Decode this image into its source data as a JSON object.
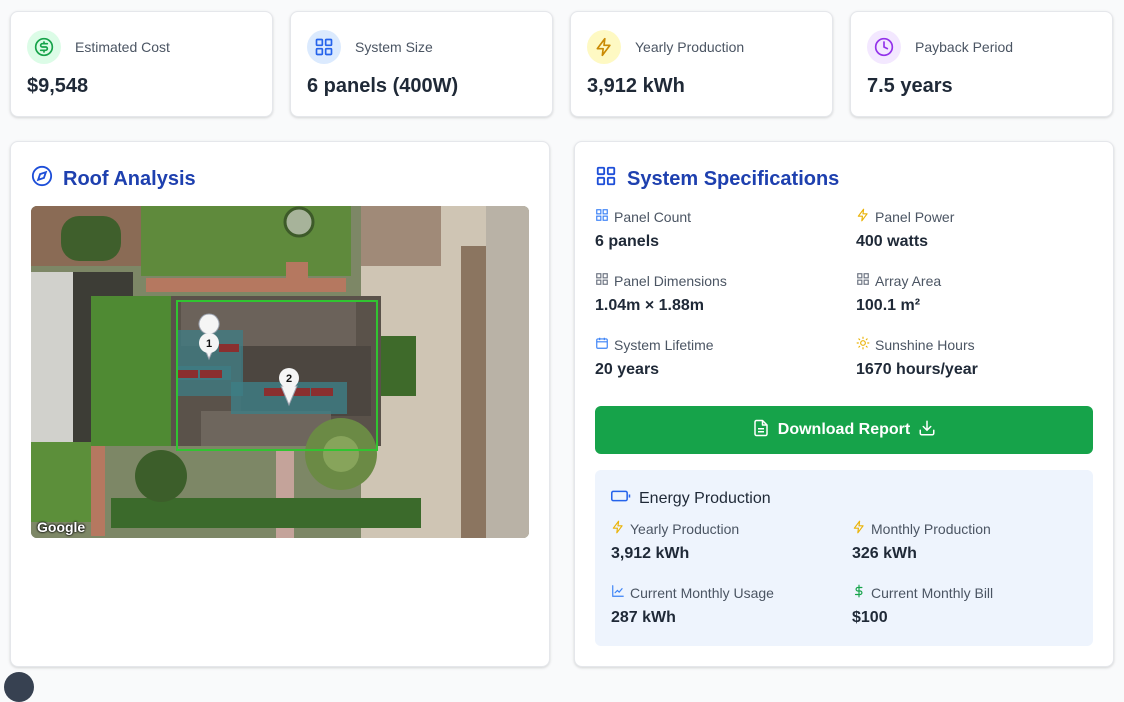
{
  "stats": [
    {
      "label": "Estimated Cost",
      "value": "$9,548",
      "icon": "dollar-circle-icon",
      "color": "#16a34a",
      "bg": "#dcfce7"
    },
    {
      "label": "System Size",
      "value": "6 panels (400W)",
      "icon": "grid-icon",
      "color": "#2563eb",
      "bg": "#dbeafe"
    },
    {
      "label": "Yearly Production",
      "value": "3,912 kWh",
      "icon": "lightning-icon",
      "color": "#ca8a04",
      "bg": "#fef9c3"
    },
    {
      "label": "Payback Period",
      "value": "7.5 years",
      "icon": "clock-icon",
      "color": "#9333ea",
      "bg": "#f3e8ff"
    }
  ],
  "roof": {
    "title": "Roof Analysis",
    "map_watermark": "Google",
    "markers": [
      "1",
      "2"
    ]
  },
  "specs": {
    "title": "System Specifications",
    "items": [
      {
        "label": "Panel Count",
        "value": "6 panels",
        "icon": "grid-icon"
      },
      {
        "label": "Panel Power",
        "value": "400 watts",
        "icon": "lightning-icon"
      },
      {
        "label": "Panel Dimensions",
        "value": "1.04m × 1.88m",
        "icon": "grid-icon"
      },
      {
        "label": "Array Area",
        "value": "100.1 m²",
        "icon": "grid-icon"
      },
      {
        "label": "System Lifetime",
        "value": "20 years",
        "icon": "calendar-icon"
      },
      {
        "label": "Sunshine Hours",
        "value": "1670 hours/year",
        "icon": "sun-icon"
      }
    ],
    "download_label": "Download Report"
  },
  "energy": {
    "title": "Energy Production",
    "items": [
      {
        "label": "Yearly Production",
        "value": "3,912 kWh",
        "icon": "lightning-icon"
      },
      {
        "label": "Monthly Production",
        "value": "326 kWh",
        "icon": "lightning-icon"
      },
      {
        "label": "Current Monthly Usage",
        "value": "287 kWh",
        "icon": "chart-line-icon"
      },
      {
        "label": "Current Monthly Bill",
        "value": "$100",
        "icon": "dollar-icon"
      }
    ]
  },
  "colors": {
    "title_blue": "#1e40af",
    "button_green": "#16a34a",
    "energy_bg": "#eef4fd"
  }
}
